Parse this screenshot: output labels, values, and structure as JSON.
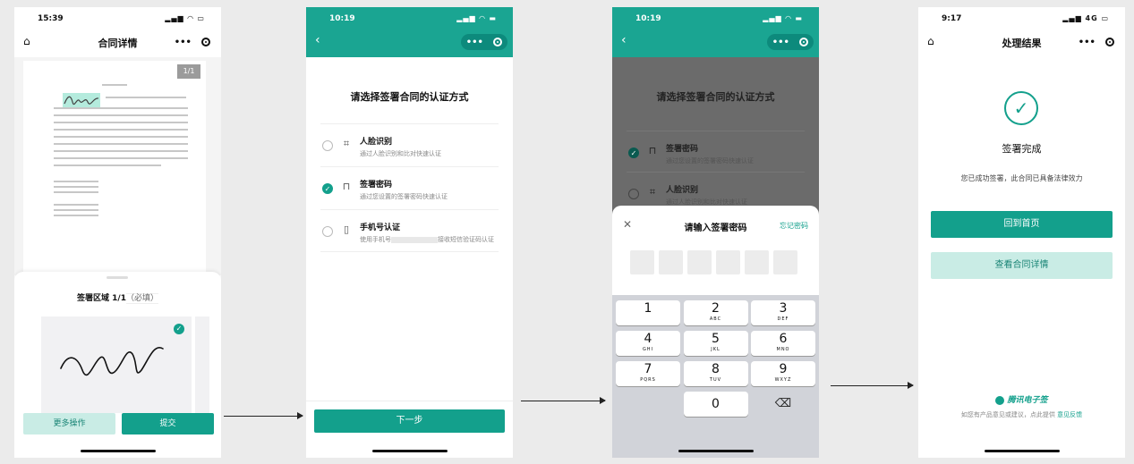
{
  "colors": {
    "accent": "#13a08c",
    "header": "#1aa592",
    "light": "#c9ece5"
  },
  "icons": {
    "home": "home-icon",
    "more": "more-dots-icon",
    "target": "record-icon",
    "back": "back-chevron-icon",
    "check": "check-icon",
    "face": "face-scan-icon",
    "lock": "lock-icon",
    "phone": "phone-icon",
    "close": "close-icon",
    "backspace": "backspace-icon"
  },
  "screen1": {
    "time": "15:39",
    "title": "合同详情",
    "page_badge": "1/1",
    "sign_area_title": "签署区域 1/1",
    "sign_area_optional": "（必填）",
    "more_button": "更多操作",
    "submit_button": "提交"
  },
  "screen2": {
    "time": "10:19",
    "question": "请选择签署合同的认证方式",
    "options": [
      {
        "name": "人脸识别",
        "desc": "通过人脸识别和比对快速认证"
      },
      {
        "name": "签署密码",
        "desc": "通过您设置的签署密码快速认证"
      },
      {
        "name": "手机号认证",
        "desc_prefix": "使用手机号",
        "desc_suffix": "接收短信验证码认证"
      }
    ],
    "next_button": "下一步"
  },
  "screen3": {
    "time": "10:19",
    "question": "请选择签署合同的认证方式",
    "options": [
      {
        "name": "签署密码",
        "desc": "通过您设置的签署密码快速认证"
      },
      {
        "name": "人脸识别",
        "desc": "通过人脸识别和比对快速认证"
      }
    ],
    "panel_title": "请输入签署密码",
    "forgot": "忘记密码",
    "keys": [
      [
        {
          "n": "1",
          "l": ""
        },
        {
          "n": "2",
          "l": "ABC"
        },
        {
          "n": "3",
          "l": "DEF"
        }
      ],
      [
        {
          "n": "4",
          "l": "GHI"
        },
        {
          "n": "5",
          "l": "JKL"
        },
        {
          "n": "6",
          "l": "MNO"
        }
      ],
      [
        {
          "n": "7",
          "l": "PQRS"
        },
        {
          "n": "8",
          "l": "TUV"
        },
        {
          "n": "9",
          "l": "WXYZ"
        }
      ]
    ],
    "zero": "0"
  },
  "screen4": {
    "time": "9:17",
    "network": "4G",
    "title": "处理结果",
    "done": "签署完成",
    "done_sub": "您已成功签署，此合同已具备法律效力",
    "home_button": "回到首页",
    "detail_button": "查看合同详情",
    "brand": "腾讯电子签",
    "feedback_prefix": "如您有产品意见或建议，点此提供",
    "feedback_link": "意见反馈"
  }
}
